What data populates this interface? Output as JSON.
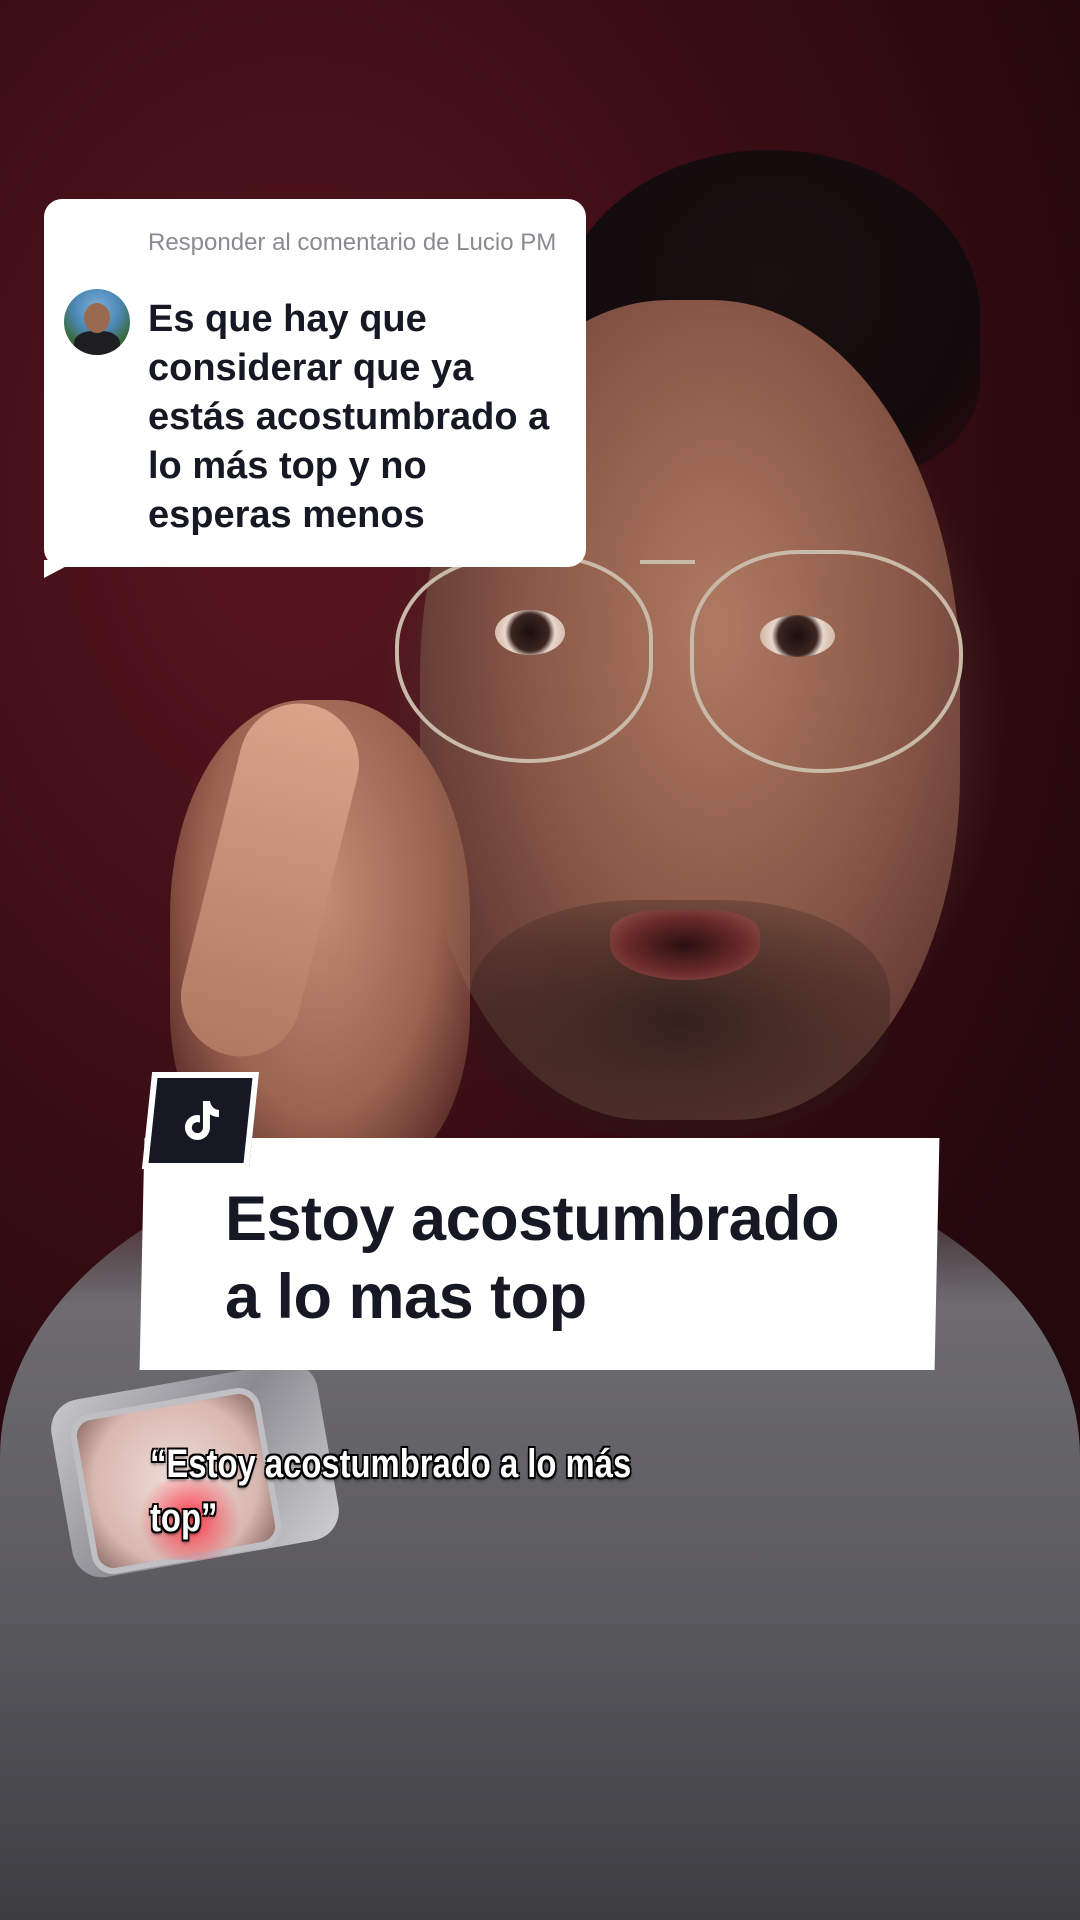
{
  "reply": {
    "header": "Responder al comentario de Lucio PM",
    "comment": "Es que hay que considerar que ya estás acostumbrado a lo más top y no esperas menos"
  },
  "title_card": {
    "icon": "tiktok-logo-icon",
    "line1": "Estoy acostumbrado",
    "line2": "a lo mas top"
  },
  "caption": {
    "line1": "“Estoy acostumbrado a lo más",
    "line2": "top”"
  },
  "colors": {
    "card_bg": "#ffffff",
    "card_text": "#161823",
    "header_text": "#8a8b91",
    "caption_text": "#ffffff"
  }
}
